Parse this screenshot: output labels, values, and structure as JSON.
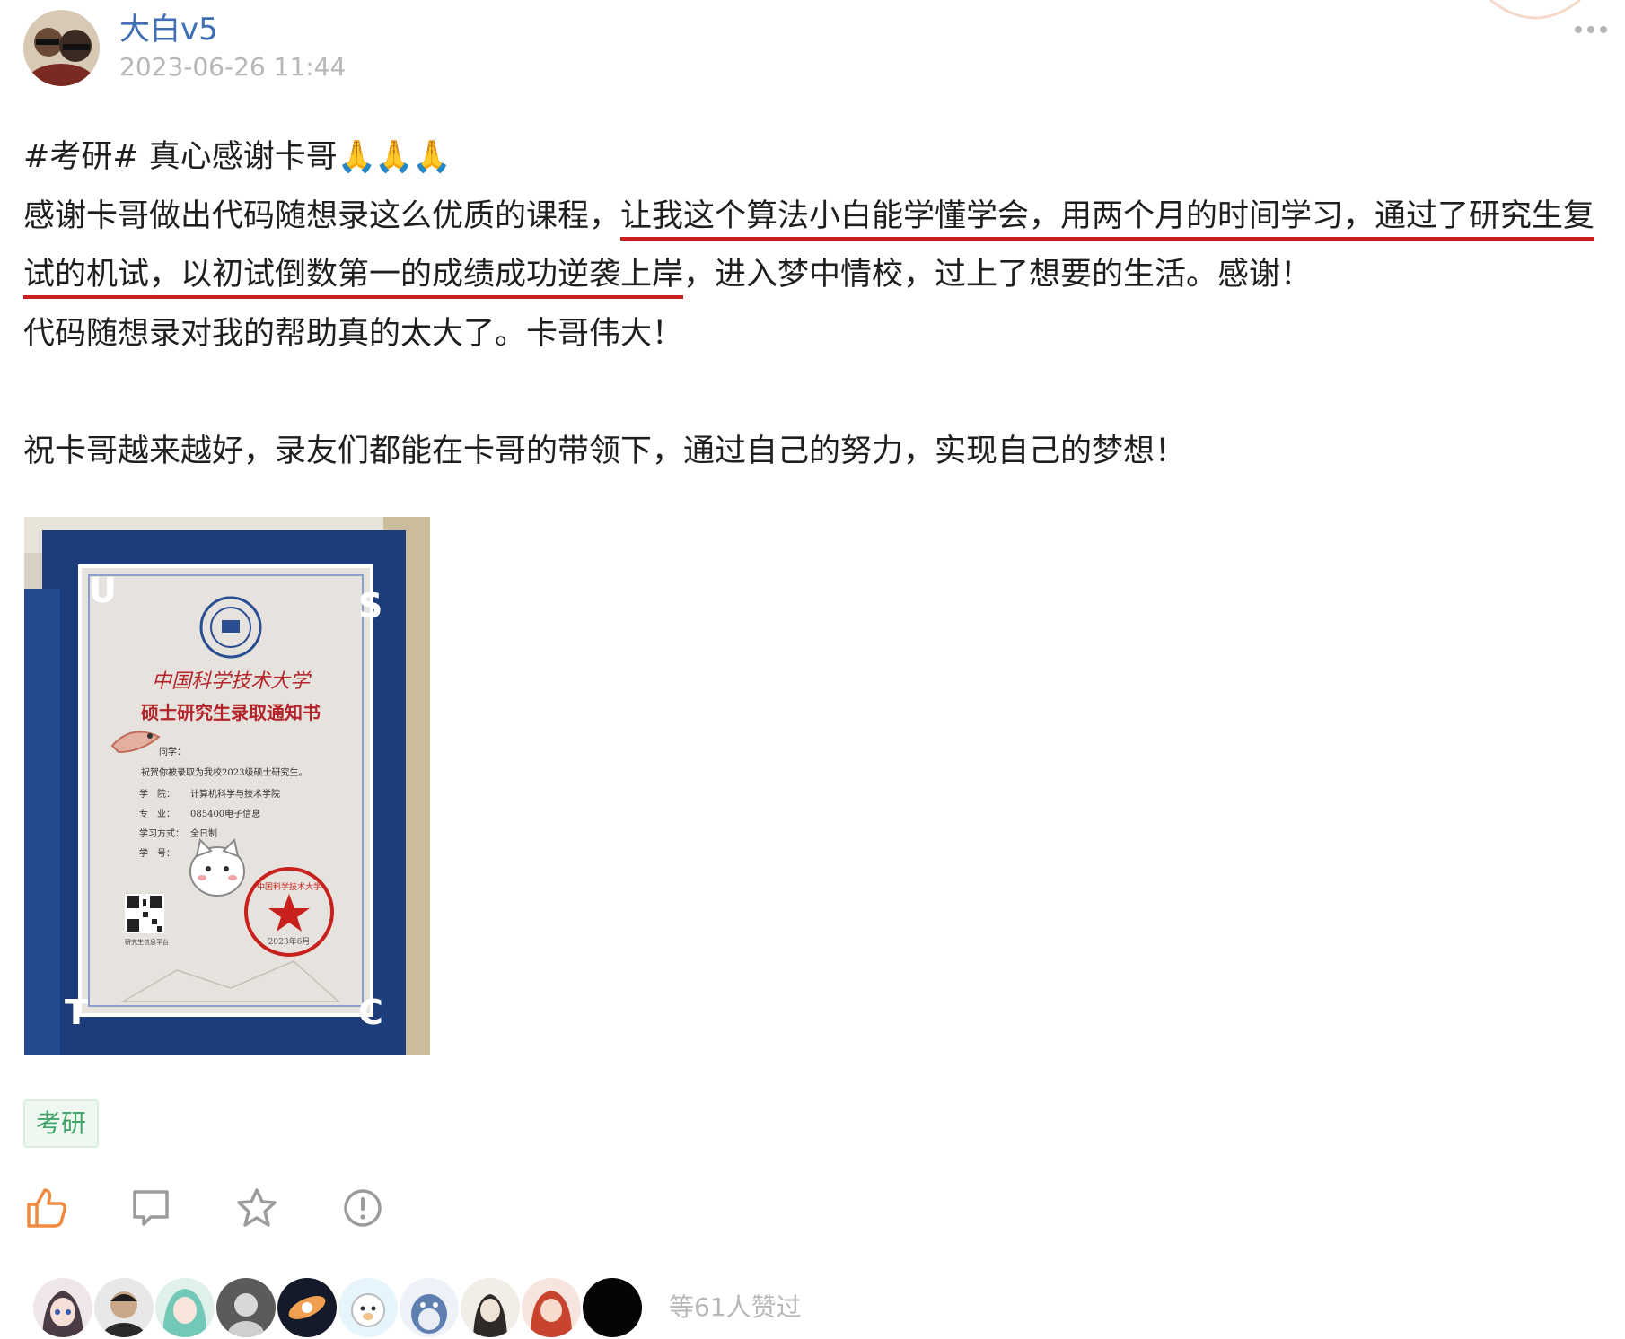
{
  "header": {
    "username": "大白v5",
    "timestamp": "2023-06-26 11:44",
    "avatar_icon": "user-avatar-icon",
    "more_icon": "more-dots-icon"
  },
  "post": {
    "title_line": "#考研# 真心感谢卡哥",
    "title_emoji": "🙏🙏🙏",
    "para1_before": "感谢卡哥做出代码随想录这么优质的课程，",
    "para1_highlight": "让我这个算法小白能学懂学会，用两个月的时间学习，通过了研究生复试的机试，以初试倒数第一的成绩成功逆袭上岸",
    "para1_after": "，进入梦中情校，过上了想要的生活。感谢！",
    "para2": "代码随想录对我的帮助真的太大了。卡哥伟大！",
    "para3": "祝卡哥越来越好，录友们都能在卡哥的带领下，通过自己的努力，实现自己的梦想！"
  },
  "image": {
    "university_name": "中国科学技术大学",
    "letter_title": "硕士研究生录取通知书",
    "greeting": "同学：",
    "body_line": "祝贺你被录取为我校2023级硕士研究生。",
    "school_label": "学　院：",
    "school_value": "计算机科学与技术学院",
    "major_label": "专　业：",
    "major_value": "085400电子信息",
    "mode_label": "学习方式：",
    "mode_value": "全日制",
    "id_label": "学　号：",
    "qr_caption": "研究生信息平台",
    "seal_text": "中国科学技术大学",
    "seal_date": "2023年6月",
    "corner_letters": [
      "U",
      "S",
      "T",
      "C"
    ]
  },
  "tag": {
    "label": "考研"
  },
  "actions": {
    "like_icon": "thumbs-up-icon",
    "comment_icon": "comment-icon",
    "favorite_icon": "star-icon",
    "report_icon": "report-icon",
    "like_color": "#f08a3e",
    "icon_color": "#9b9b9b"
  },
  "likers": {
    "count_text": "等61人赞过",
    "avatars": [
      "liker-1",
      "liker-2",
      "liker-3",
      "liker-4",
      "liker-5",
      "liker-6",
      "liker-7",
      "liker-8",
      "liker-9",
      "liker-10"
    ]
  },
  "colors": {
    "username": "#3f6fb5",
    "underline": "#c8201c",
    "tag_text": "#43a56b",
    "tag_bg": "#eef8f1",
    "muted": "#b7b7b7"
  }
}
